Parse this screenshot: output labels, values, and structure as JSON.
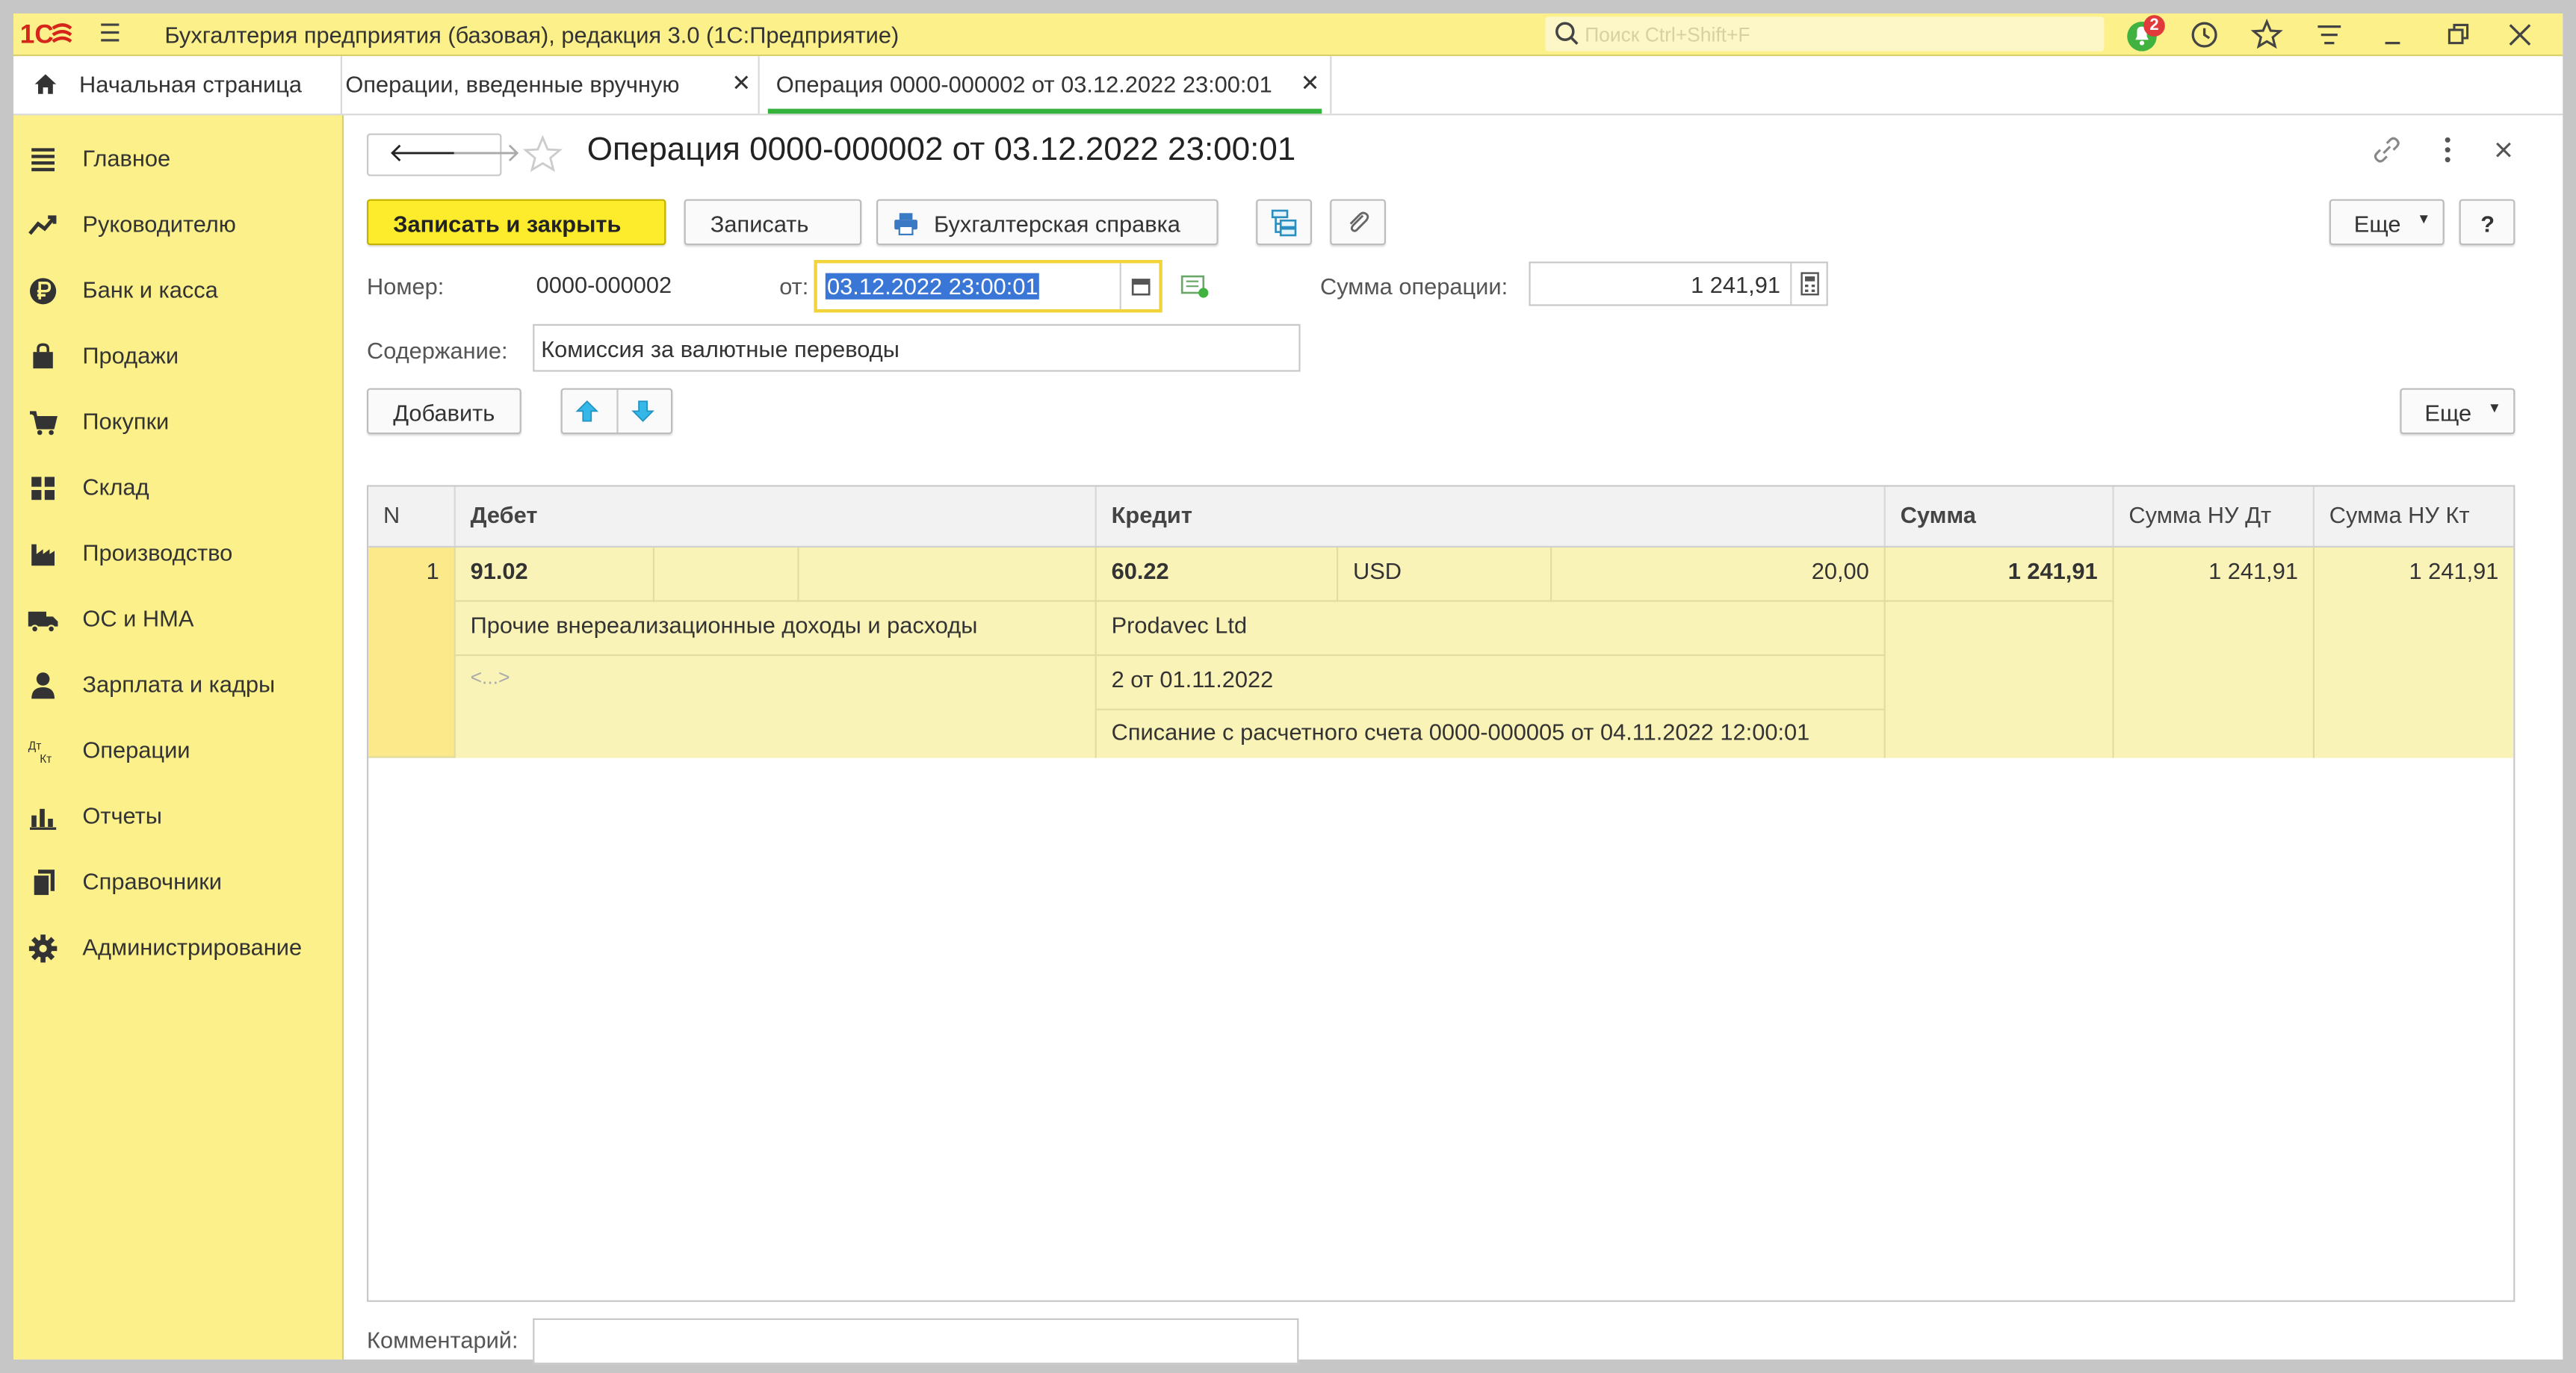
{
  "titlebar": {
    "app_title": "Бухгалтерия предприятия (базовая), редакция 3.0  (1С:Предприятие)",
    "search_placeholder": "Поиск Ctrl+Shift+F",
    "notifications_count": "2"
  },
  "tabs": [
    {
      "label": "Начальная страница"
    },
    {
      "label": "Операции, введенные вручную"
    },
    {
      "label": "Операция 0000-000002 от 03.12.2022 23:00:01"
    }
  ],
  "sidebar": {
    "items": [
      {
        "label": "Главное",
        "icon": "menu-lines-icon"
      },
      {
        "label": "Руководителю",
        "icon": "trend-chart-icon"
      },
      {
        "label": "Банк и касса",
        "icon": "ruble-coin-icon"
      },
      {
        "label": "Продажи",
        "icon": "shopping-bag-icon"
      },
      {
        "label": "Покупки",
        "icon": "cart-icon"
      },
      {
        "label": "Склад",
        "icon": "warehouse-grid-icon"
      },
      {
        "label": "Производство",
        "icon": "factory-icon"
      },
      {
        "label": "ОС и НМА",
        "icon": "truck-icon"
      },
      {
        "label": "Зарплата и кадры",
        "icon": "person-icon"
      },
      {
        "label": "Операции",
        "icon": "debit-credit-icon"
      },
      {
        "label": "Отчеты",
        "icon": "bar-chart-icon"
      },
      {
        "label": "Справочники",
        "icon": "documents-icon"
      },
      {
        "label": "Администрирование",
        "icon": "gear-icon"
      }
    ]
  },
  "form": {
    "title": "Операция 0000-000002 от 03.12.2022 23:00:01",
    "buttons": {
      "save_close": "Записать и закрыть",
      "save": "Записать",
      "report": "Бухгалтерская справка",
      "more": "Еще",
      "help": "?",
      "add": "Добавить",
      "more_table": "Еще"
    },
    "number_label": "Номер:",
    "number_value": "0000-000002",
    "date_label": "от:",
    "date_value": "03.12.2022 23:00:01",
    "sum_label": "Сумма операции:",
    "sum_value": "1 241,91",
    "content_label": "Содержание:",
    "content_value": "Комиссия за валютные переводы",
    "comment_label": "Комментарий:",
    "comment_value": ""
  },
  "table": {
    "columns": [
      "N",
      "Дебет",
      "Кредит",
      "Сумма",
      "Сумма НУ Дт",
      "Сумма НУ Кт"
    ],
    "rows": [
      {
        "n": "1",
        "debit_account": "91.02",
        "debit_subconto1": "Прочие внереализационные доходы и расходы",
        "debit_subconto2": "<...>",
        "credit_account": "60.22",
        "credit_currency": "USD",
        "credit_currency_amount": "20,00",
        "credit_subconto1": "Prodavec Ltd",
        "credit_subconto2": "2 от 01.11.2022",
        "credit_subconto3": "Списание с расчетного счета 0000-000005 от 04.11.2022 12:00:01",
        "sum": "1 241,91",
        "sum_nu_dt": "1 241,91",
        "sum_nu_kt": "1 241,91"
      }
    ]
  },
  "colors": {
    "accent_yellow": "#fbf08a",
    "primary_button": "#fcec2b",
    "active_tab_underline": "#33b33c",
    "selected_row": "#faf3b8",
    "badge_red": "#e23a3a"
  }
}
